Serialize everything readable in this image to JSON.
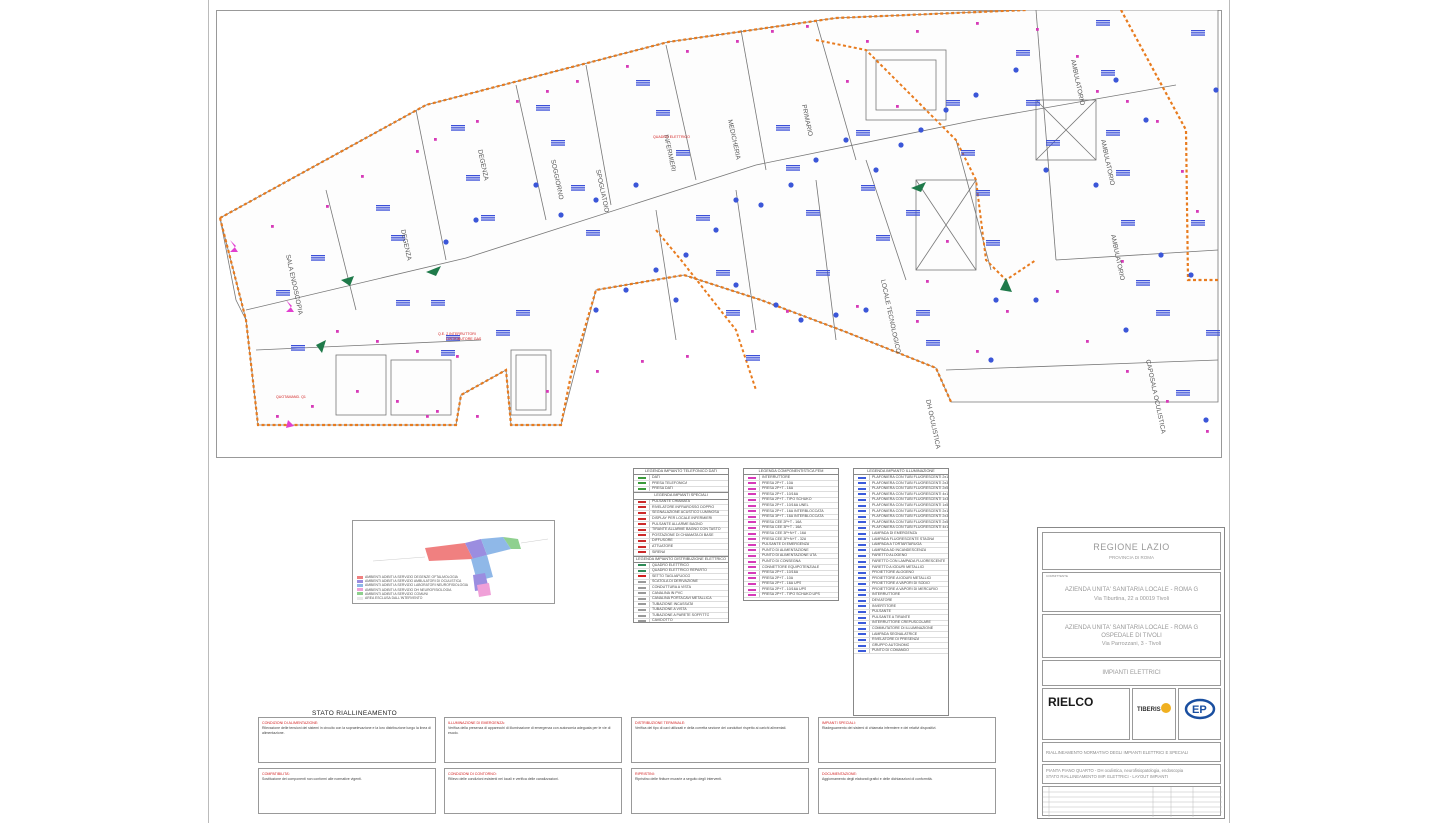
{
  "plan": {
    "rooms": [
      "SALA ENDOSCOPIA",
      "DEGENZA",
      "DEGENZA",
      "SOGGIORNO",
      "INFERMIERI",
      "MEDICHERIA",
      "PRIMARIO",
      "LOCALE TECNOLOGICO",
      "DH OCULISTICA",
      "AMBULATORIO",
      "AMBULATORIO",
      "AMBULATORIO",
      "CAPOSALA OCULISTICA",
      "SPOGLIATOIO"
    ],
    "red_labels": [
      "QUOTAMAND. Q1",
      "DISTRIBUTORE GAS",
      "QUADRO ELETTRICO",
      "Q.E. 2 INTERRUTTORI"
    ]
  },
  "legend_tel": {
    "title": "LEGENDA IMPIANTO TELEFONICO DATI",
    "rows": [
      {
        "text": "DATI",
        "color": "#3a9a3a"
      },
      {
        "text": "PRESA TELEFONICA",
        "color": "#3a9a3a"
      },
      {
        "text": "PRESA DATI",
        "color": "#3a9a3a"
      }
    ],
    "sub1": "LEGENDA IMPIANTI SPECIALI",
    "rows2": [
      {
        "text": "PULSANTE CHIAMATA",
        "color": "#cc2b2b"
      },
      {
        "text": "RIVELATORE INFRAROSSO DOPPIO",
        "color": "#cc2b2b"
      },
      {
        "text": "SEGNALAZIONE ACUSTICO LUMINOSA",
        "color": "#cc2b2b"
      },
      {
        "text": "DISPLAY PER LOCALE INFERMIERI",
        "color": "#cc2b2b"
      },
      {
        "text": "PULSANTE ALLARME BAGNO",
        "color": "#cc2b2b"
      },
      {
        "text": "TIRANTE ALLARME BAGNO CON TASTO",
        "color": "#cc2b2b"
      },
      {
        "text": "POSTAZIONE DI CHIAMATA DI BASE",
        "color": "#cc2b2b"
      },
      {
        "text": "DIFFUSORE",
        "color": "#cc2b2b"
      },
      {
        "text": "ATTUATORE",
        "color": "#cc2b2b"
      },
      {
        "text": "SIRENA",
        "color": "#cc2b2b"
      }
    ],
    "sub2": "LEGENDA IMPIANTO DISTRIBUZIONE ELETTRICO",
    "rows3": [
      {
        "text": "QUADRO ELETTRICO",
        "color": "#2e8b57"
      },
      {
        "text": "QUADRO ELETTRICO REPARTO",
        "color": "#2e8b57"
      },
      {
        "text": "SETTO TAGLIAFUOCO",
        "color": "#d21f1f"
      },
      {
        "text": "SCATOLA DI DERIVAZIONE",
        "color": "#999999"
      },
      {
        "text": "CONDUTTURA A VISTA",
        "color": "#999999"
      },
      {
        "text": "CANALINA IN PVC",
        "color": "#999999"
      },
      {
        "text": "CANALINA PORTACAVI METALLICA",
        "color": "#999999"
      },
      {
        "text": "TUBAZIONE INCASSATA",
        "color": "#999999"
      },
      {
        "text": "TUBAZIONE A VISTA",
        "color": "#999999"
      },
      {
        "text": "TUBAZIONE A PARETE SOFFITTO",
        "color": "#999999"
      },
      {
        "text": "CAVIDOTTO",
        "color": "#999999"
      },
      {
        "text": "POZZETTO DI ISPEZIONE",
        "color": "#999999"
      }
    ]
  },
  "legend_fem": {
    "title": "LEGENDA COMPONENTISTICA FEM",
    "rows": [
      "INTERRUTTORE",
      "PRESA 2P+T - 10A",
      "PRESA 2P+T - 16A",
      "PRESA 2P+T - 10/16A",
      "PRESA 2P+T - TIPO SCHUKO",
      "PRESA 2P+T - 10/16A UNEL",
      "PRESA 2P+T - 16A INTERBLOCCATA",
      "PRESA 3P+T - 16A INTERBLOCCATA",
      "PRESA CEE 2P+T - 16A",
      "PRESA CEE 3P+T - 16A",
      "PRESA CEE 3P+N+T - 16A",
      "PRESA CEE 3P+N+T - 32A",
      "PULSANTE DI EMERGENZA",
      "PUNTO DI ALIMENTAZIONE",
      "PUNTO DI ALIMENTAZIONE UTA",
      "PUNTO DI CONSEGNA",
      "CONNETTORE EQUIPOTENZIALE",
      "PRESA 2P+T - 10/16A",
      "PRESA 2P+T - 10A",
      "PRESA 2P+T - 16A UPS",
      "PRESA 2P+T - 10/16A UPS",
      "PRESA 2P+T - TIPO SCHUKO UPS"
    ]
  },
  "legend_ill": {
    "title": "LEGENDA IMPIANTO ILLUMINAZIONE",
    "rows": [
      "PLAFONIERA CON TUBI FLUORESCENTI 2x18W",
      "PLAFONIERA CON TUBI FLUORESCENTI 2x36W",
      "PLAFONIERA CON TUBI FLUORESCENTI 2x58W",
      "PLAFONIERA CON TUBI FLUORESCENTI 4x18W",
      "PLAFONIERA CON TUBI FLUORESCENTI 1x36W",
      "PLAFONIERA CON TUBI FLUORESCENTI 1x58W",
      "PLAFONIERA CON TUBI FLUORESCENTI 2x18W",
      "PLAFONIERA CON TUBI FLUORESCENTI 2x36W",
      "PLAFONIERA CON TUBI FLUORESCENTI 2x58W",
      "PLAFONIERA CON TUBI FLUORESCENTI 4x18W",
      "LAMPADA DI EMERGENZA",
      "LAMPADA FLUORESCENTE STAGNA",
      "LAMPADA A TORTARTARUGA",
      "LAMPADA AD INCANDESCENZA",
      "FARETTO ALOGENO",
      "FARETTO CON LAMPADA FLUORESCENTE",
      "FARETTO A IODURI METALLICI",
      "PROIETTORE ALOGENO",
      "PROIETTORE A IODURI METALLICI",
      "PROIETTORE A VAPORI DI SODIO",
      "PROIETTORE A VAPORI DI MERCURIO",
      "INTERRUTTORE",
      "DEVIATORE",
      "INVERTITORE",
      "PULSANTE",
      "PULSANTE A TIRANTE",
      "INTERRUTTORE CREPUSCOLARE",
      "COMMUTATORE DI ILLUMINAZIONE",
      "LAMPADA SEGNALATRICE",
      "RIVELATORE DI PRESENZA",
      "GRUPPO AUTONOMO",
      "PUNTO DI COMANDO"
    ]
  },
  "keymap_legend": [
    {
      "text": "AMBIENTI ADIBITI A SERVIZIO DEGENZE OFTALMOLOGIA",
      "color": "#f08080"
    },
    {
      "text": "AMBIENTI ADIBITI A SERVIZIO AMBULATORI DI OCULISTICA",
      "color": "#9b8de0"
    },
    {
      "text": "AMBIENTI ADIBITI A SERVIZIO LABORATORI NEUROFISIOLOGIA",
      "color": "#8fb8e8"
    },
    {
      "text": "AMBIENTI ADIBITI A SERVIZIO DH NEUROFISIOLOGIA",
      "color": "#f0a0d8"
    },
    {
      "text": "AMBIENTI ADIBITI A SERVIZIO COMUNI",
      "color": "#8fd08f"
    },
    {
      "text": "AREA ESCLUSA DALL'INTERVENTO",
      "color": "#e8e8e8"
    }
  ],
  "stato": {
    "title": "STATO  RIALLINEAMENTO",
    "notes": [
      {
        "title": "CONDIZIONI DI ALIMENTAZIONE:",
        "body": "Rilevazione delle tensioni dei sistemi in circuito con la sopraelevazione e la loro distribuzione lungo la linea di alimentazione."
      },
      {
        "title": "ILLUMINAZIONE DI EMERGENZA:",
        "body": "Verifica della presenza di apparecchi di illuminazione di emergenza con autonomia adeguata per le vie di esodo."
      },
      {
        "title": "DISTRIBUZIONE TERMINALE:",
        "body": "Verifica del tipo di cavi utilizzati e della corretta sezione dei conduttori rispetto ai carichi alimentati."
      },
      {
        "title": "IMPIANTI SPECIALI:",
        "body": "Riadeguamento dei sistemi di chiamata infermiere e dei relativi dispositivi."
      },
      {
        "title": "COMPATIBILITA':",
        "body": "Sostituzione dei componenti non conformi alle normative vigenti."
      },
      {
        "title": "CONDIZIONI DI CONTORNO:",
        "body": "Rilievo delle condizioni esistenti nei locali e verifica delle canalizzazioni."
      },
      {
        "title": "RIPRISTINI:",
        "body": "Ripristino delle finiture murarie a seguito degli interventi."
      },
      {
        "title": "DOCUMENTAZIONE:",
        "body": "Aggiornamento degli elaborati grafici e delle dichiarazioni di conformità."
      }
    ]
  },
  "title_block": {
    "region": "REGIONE LAZIO",
    "province": "PROVINCIA DI ROMA",
    "client_label": "COMMITTENTE",
    "client1": "AZIENDA UNITA' SANITARIA LOCALE - ROMA G",
    "client1_addr": "Via Tiburtina, 22 a  00019 Tivoli",
    "client2": "AZIENDA UNITA' SANITARIA LOCALE - ROMA G",
    "client2_sub": "OSPEDALE DI TIVOLI",
    "client2_addr": "Via Parrozzani, 3 - Tivoli",
    "discipline": "IMPIANTI ELETTRICI",
    "logo_rielco": "RIELCO",
    "logo_tiberis": "TIBERIS",
    "subject1": "RIALLINEAMENTO NORMATIVO DEGLI IMPIANTI ELETTRICI E SPECIALI",
    "subject2": "PIANTA PIANO QUARTO - DH oculistica, neurofisiopatologia, endoscopia",
    "subject3": "STATO RIALLINEAMENTO IMP. ELETTRICI - LAYOUT IMPIANTI"
  }
}
